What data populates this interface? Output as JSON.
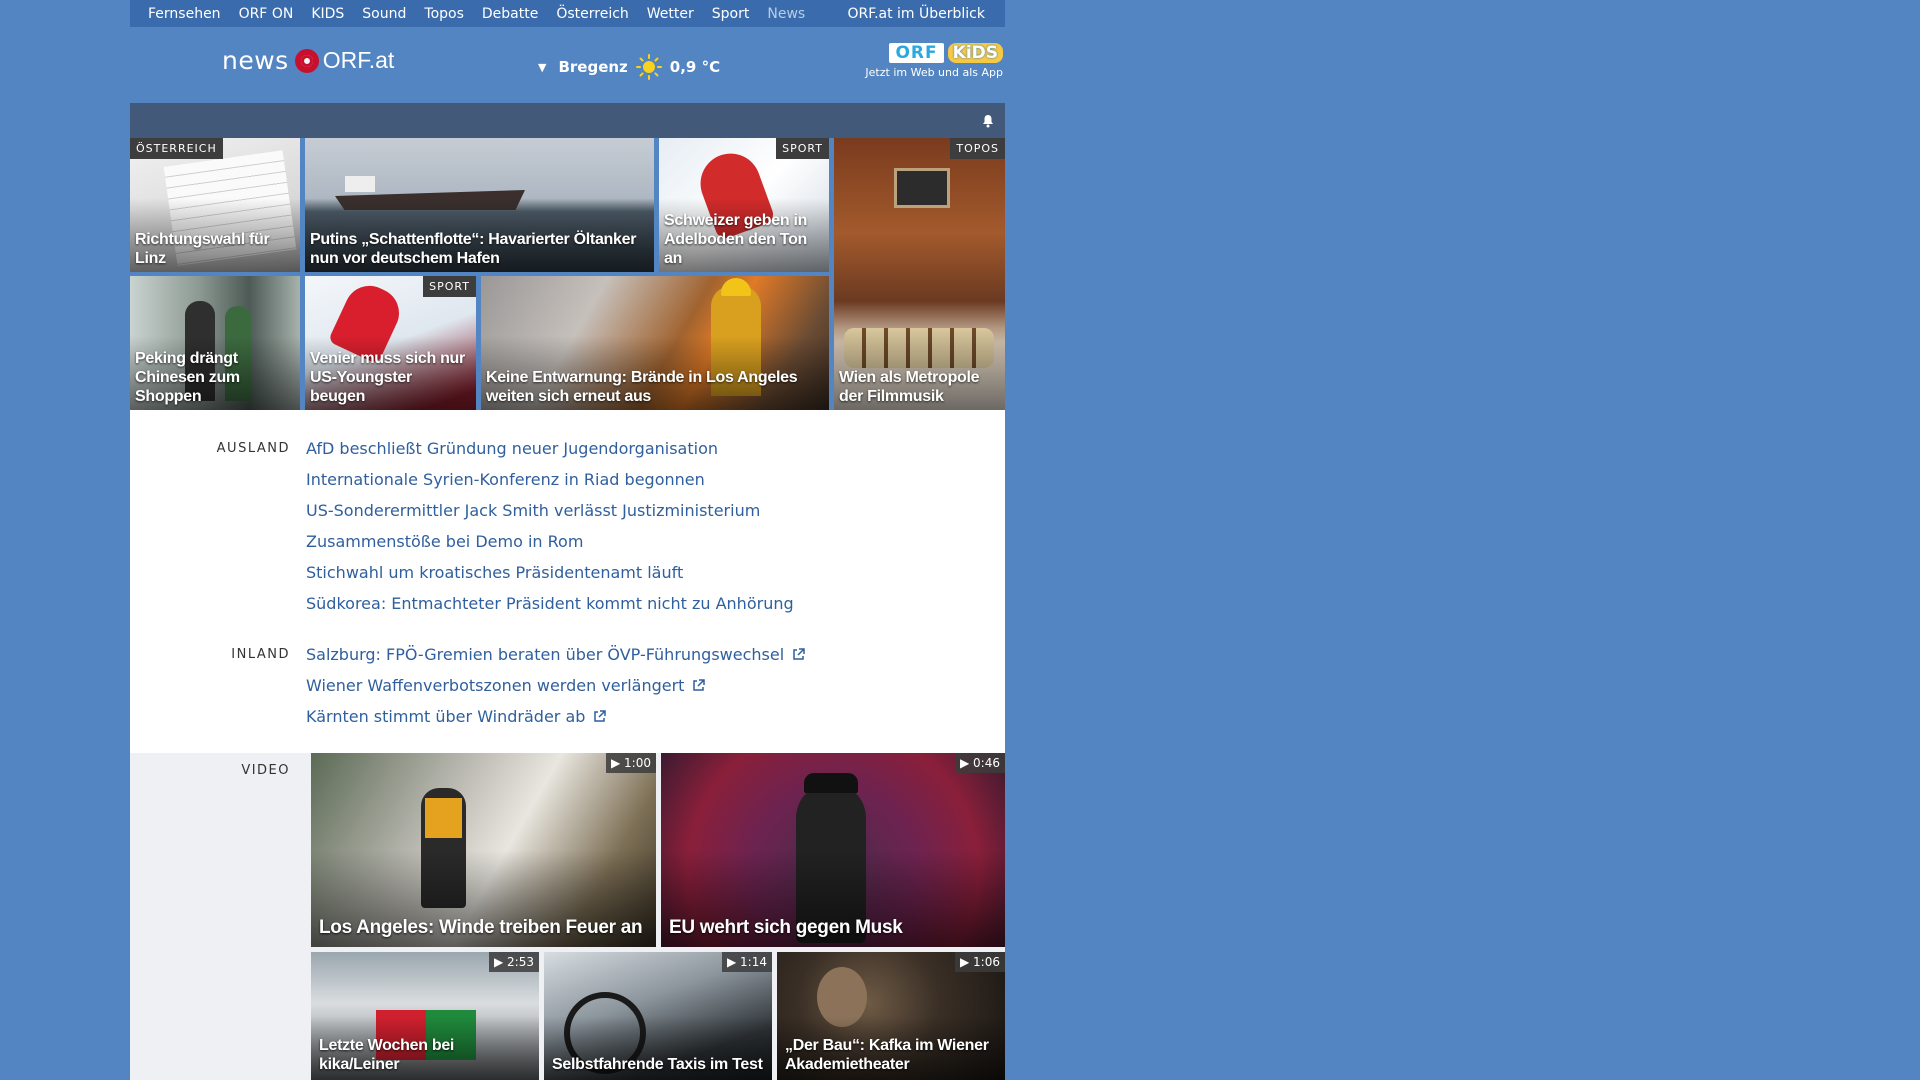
{
  "nav": {
    "items": [
      "Fernsehen",
      "ORF ON",
      "KIDS",
      "Sound",
      "Topos",
      "Debatte",
      "Österreich",
      "Wetter",
      "Sport",
      "News"
    ],
    "overview": "ORF.at im Überblick"
  },
  "header": {
    "logo_news": "news",
    "logo_orf": "ORF.at",
    "weather": {
      "city": "Bregenz",
      "temp": "0,9 °C",
      "icon": "sun-icon"
    },
    "kids": {
      "orf": "ORF",
      "kids": "KiDS",
      "sub": "Jetzt im Web und als App"
    }
  },
  "teasers": [
    {
      "title": "Richtungswahl für Linz",
      "tag": "ÖSTERREICH"
    },
    {
      "title": "Putins „Schattenflotte“: Havarierter Öltanker nun vor deutschem Hafen",
      "tag": ""
    },
    {
      "title": "Schweizer geben in Adelboden den Ton an",
      "tag": "SPORT"
    },
    {
      "title": "",
      "tag": "TOPOS"
    },
    {
      "title": "Peking drängt Chinesen zum Shoppen",
      "tag": ""
    },
    {
      "title": "Venier muss sich nur US-Youngster beugen",
      "tag": "SPORT"
    },
    {
      "title": "Keine Entwarnung: Brände in Los Angeles weiten sich erneut aus",
      "tag": ""
    },
    {
      "title": "Wien als Metropole der Filmmusik",
      "tag": ""
    }
  ],
  "ausland": {
    "label": "AUSLAND",
    "links": [
      "AfD beschließt Gründung neuer Jugendorganisation",
      "Internationale Syrien-Konferenz in Riad begonnen",
      "US-Sonderermittler Jack Smith verlässt Justizministerium",
      "Zusammenstöße bei Demo in Rom",
      "Stichwahl um kroatisches Präsidentenamt läuft",
      "Südkorea: Entmachteter Präsident kommt nicht zu Anhörung"
    ]
  },
  "inland": {
    "label": "INLAND",
    "links": [
      "Salzburg: FPÖ-Gremien beraten über ÖVP-Führungswechsel",
      "Wiener Waffenverbotszonen werden verlängert",
      "Kärnten stimmt über Windräder ab"
    ]
  },
  "video": {
    "label": "VIDEO",
    "items": [
      {
        "title": "Los Angeles: Winde treiben Feuer an",
        "duration": "1:00"
      },
      {
        "title": "EU wehrt sich gegen Musk",
        "duration": "0:46"
      },
      {
        "title": "Letzte Wochen bei kika/Leiner",
        "duration": "2:53"
      },
      {
        "title": "Selbstfahrende Taxis im Test",
        "duration": "1:14"
      },
      {
        "title": "„Der Bau“: Kafka im Wiener Akademietheater",
        "duration": "1:06"
      }
    ]
  },
  "colors": {
    "page_bg": "#5285c2",
    "nav_bg": "#3a6cad",
    "link": "#2f5f9e",
    "bar": "#43597a"
  }
}
